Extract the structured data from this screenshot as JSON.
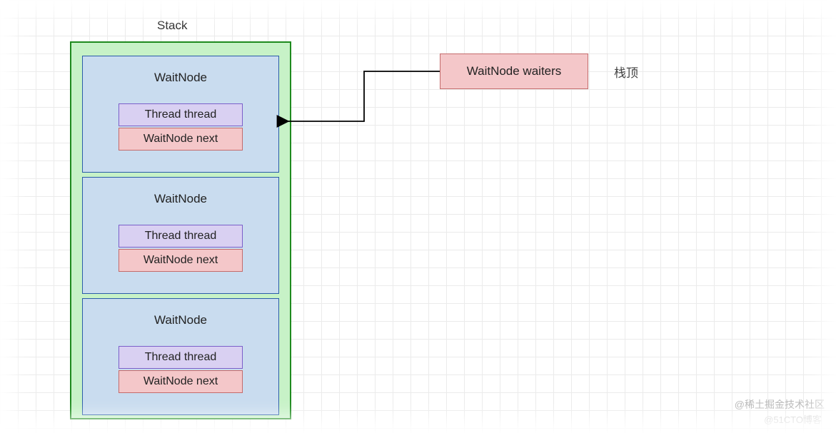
{
  "title": "Stack",
  "stack_top_label": "栈顶",
  "waiters_label": "WaitNode waiters",
  "nodes": [
    {
      "name": "WaitNode",
      "thread": "Thread thread",
      "next": "WaitNode next"
    },
    {
      "name": "WaitNode",
      "thread": "Thread thread",
      "next": "WaitNode next"
    },
    {
      "name": "WaitNode",
      "thread": "Thread thread",
      "next": "WaitNode next"
    }
  ],
  "watermarks": {
    "line1": "@稀土掘金技术社区",
    "line2": "@51CTO博客"
  },
  "colors": {
    "stack_fill": "#c7f2c7",
    "stack_border": "#1e8a1e",
    "node_fill": "#c9dcef",
    "node_border": "#2b5ca8",
    "thread_fill": "#d9d0f2",
    "thread_border": "#7b5fc9",
    "next_fill": "#f4c7c9",
    "next_border": "#c46b6b"
  }
}
